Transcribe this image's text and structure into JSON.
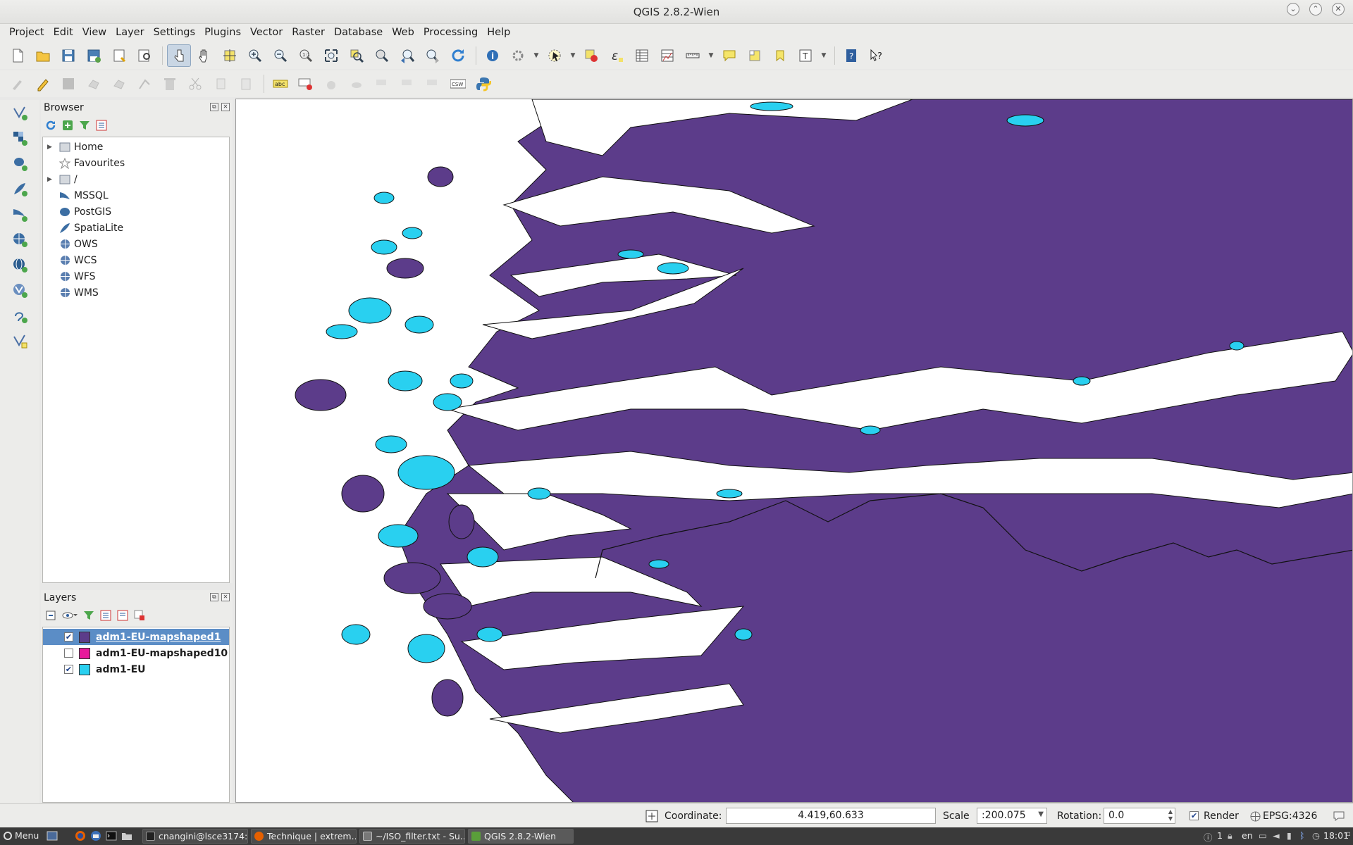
{
  "window": {
    "title": "QGIS 2.8.2-Wien"
  },
  "menu": [
    "Project",
    "Edit",
    "View",
    "Layer",
    "Settings",
    "Plugins",
    "Vector",
    "Raster",
    "Database",
    "Web",
    "Processing",
    "Help"
  ],
  "toolbar2": {
    "csw_label": "CSW",
    "abc_label": "abc"
  },
  "browser": {
    "title": "Browser",
    "items": [
      {
        "label": "Home",
        "icon": "folder-icon",
        "expandable": true
      },
      {
        "label": "Favourites",
        "icon": "star-icon",
        "expandable": false
      },
      {
        "label": "/",
        "icon": "folder-icon",
        "expandable": true
      },
      {
        "label": "MSSQL",
        "icon": "mssql-icon",
        "expandable": false
      },
      {
        "label": "PostGIS",
        "icon": "postgis-icon",
        "expandable": false
      },
      {
        "label": "SpatiaLite",
        "icon": "spatialite-icon",
        "expandable": false
      },
      {
        "label": "OWS",
        "icon": "globe-icon",
        "expandable": false
      },
      {
        "label": "WCS",
        "icon": "globe-icon",
        "expandable": false
      },
      {
        "label": "WFS",
        "icon": "globe-icon",
        "expandable": false
      },
      {
        "label": "WMS",
        "icon": "globe-icon",
        "expandable": false
      }
    ]
  },
  "layers": {
    "title": "Layers",
    "items": [
      {
        "label": "adm1-EU-mapshaped1",
        "checked": true,
        "color": "#5c3c8a",
        "selected": true
      },
      {
        "label": "adm1-EU-mapshaped10",
        "checked": false,
        "color": "#e8189b",
        "selected": false
      },
      {
        "label": "adm1-EU",
        "checked": true,
        "color": "#29d0f0",
        "selected": false
      }
    ]
  },
  "map": {
    "land_color": "#5c3c8a",
    "island_color": "#29d0f0",
    "sea_color": "#ffffff"
  },
  "status": {
    "coordinate_label": "Coordinate:",
    "coordinate_value": "4.419,60.633",
    "scale_label": "Scale",
    "scale_value": ":200.075",
    "rotation_label": "Rotation:",
    "rotation_value": "0.0",
    "render_label": "Render",
    "render_checked": true,
    "crs": "EPSG:4326"
  },
  "taskbar": {
    "menu_label": "Menu",
    "tasks": [
      {
        "label": "cnangini@lsce3174:...",
        "color": "#222222"
      },
      {
        "label": "Technique | extrem...",
        "color": "#e66000"
      },
      {
        "label": "~/ISO_filter.txt - Su...",
        "color": "#777777"
      },
      {
        "label": "QGIS 2.8.2-Wien",
        "color": "#5a9e3a"
      }
    ],
    "tray": {
      "workspace": "1",
      "lang": "en",
      "time": "18:01"
    }
  }
}
